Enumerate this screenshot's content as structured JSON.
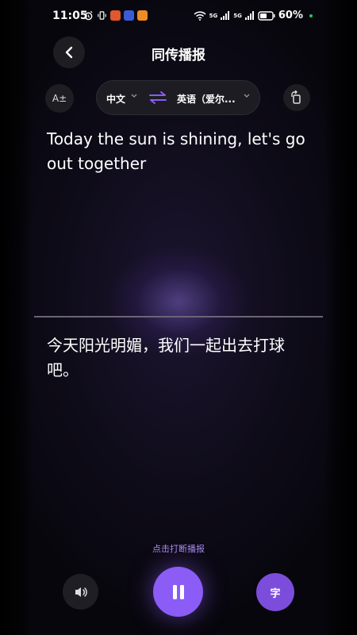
{
  "status_bar": {
    "time": "11:05",
    "network_5g_a": "5G",
    "network_5g_b": "5G",
    "battery": "60%"
  },
  "header": {
    "title": "同传播报"
  },
  "toolbar": {
    "font_size_label": "A±",
    "source_lang": "中文",
    "target_lang": "英语（爱尔...",
    "icons": [
      "chevron-down-icon",
      "swap-icon",
      "rotate-screen-icon"
    ]
  },
  "source_text": "Today the sun is shining, let's go out together",
  "translation_text": "今天阳光明媚，我们一起出去打球吧。",
  "bottom": {
    "hint": "点击打断播报",
    "text_button": "字"
  },
  "colors": {
    "accent": "#8b5cf6",
    "hint": "#a88cf0"
  }
}
